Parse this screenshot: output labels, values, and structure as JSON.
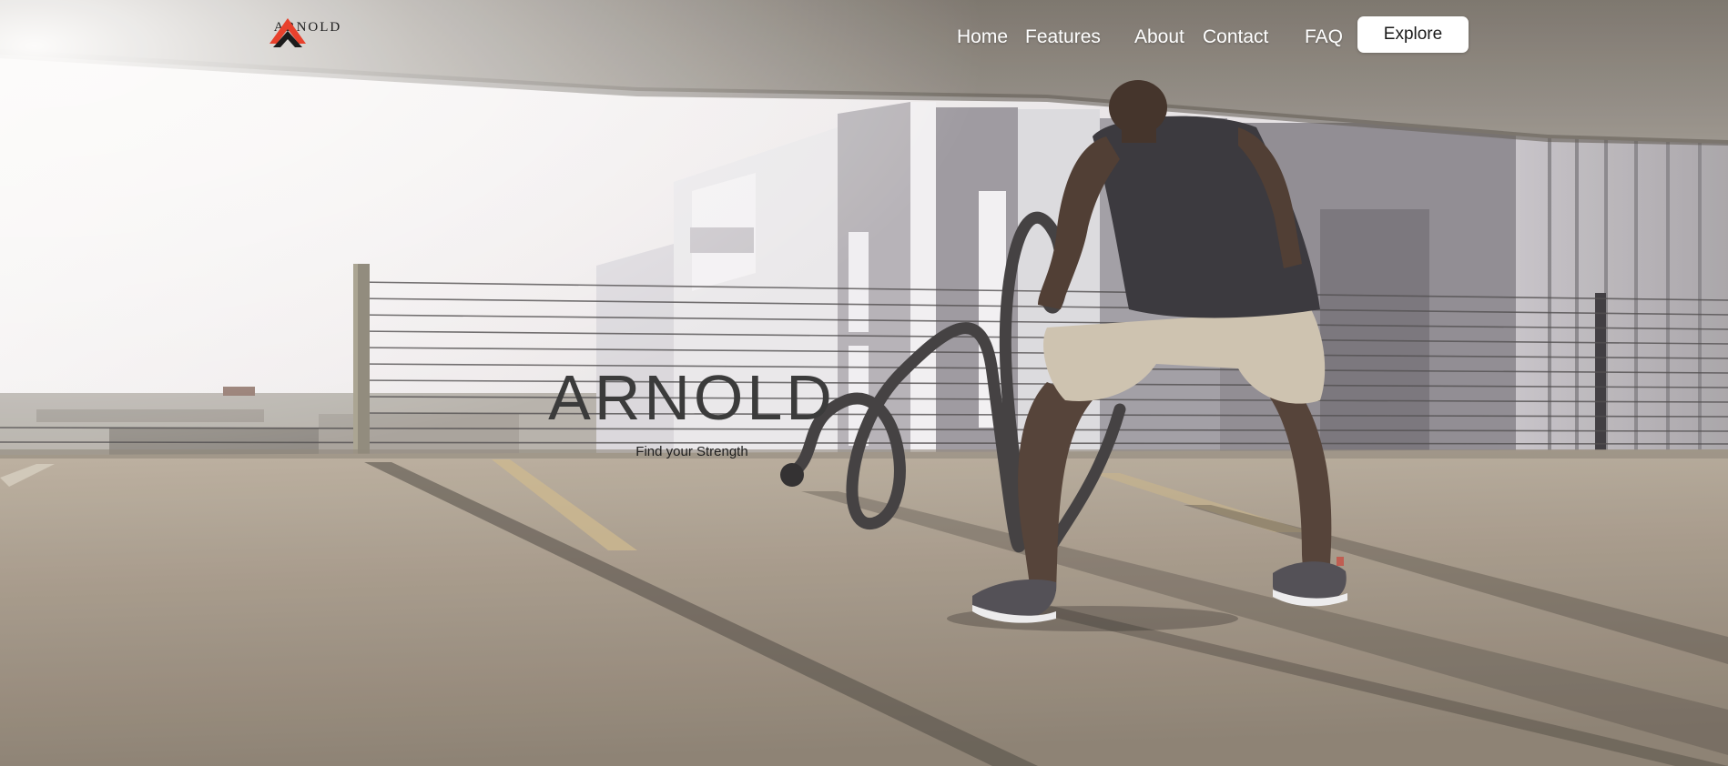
{
  "brand": {
    "name": "ARNOLD"
  },
  "nav": {
    "links": [
      "Home",
      "Features",
      "About",
      "Contact",
      "FAQ"
    ],
    "cta_label": "Explore"
  },
  "hero": {
    "title": "ARNOLD",
    "subtitle": "Find your Strength"
  },
  "colors": {
    "logo_red": "#e8412c",
    "logo_dark": "#1c1c1c",
    "nav_text": "#ffffff",
    "cta_bg": "#ffffff",
    "title_text": "#3b3b3b"
  }
}
